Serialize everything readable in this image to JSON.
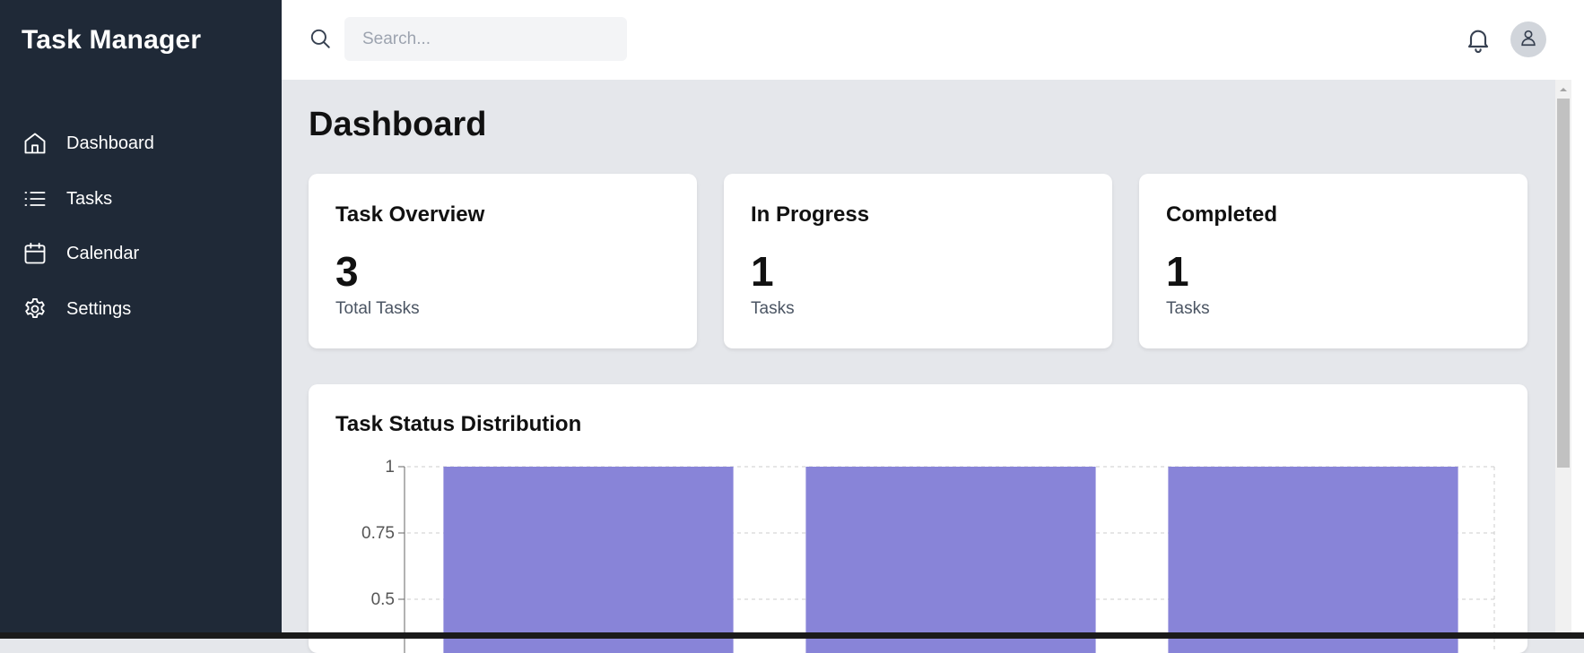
{
  "app": {
    "title": "Task Manager"
  },
  "sidebar": {
    "items": [
      {
        "label": "Dashboard",
        "icon": "home-icon"
      },
      {
        "label": "Tasks",
        "icon": "list-icon"
      },
      {
        "label": "Calendar",
        "icon": "calendar-icon"
      },
      {
        "label": "Settings",
        "icon": "gear-icon"
      }
    ]
  },
  "header": {
    "search_placeholder": "Search...",
    "search_value": "",
    "icons": [
      "search-icon",
      "bell-icon",
      "user-icon"
    ]
  },
  "main": {
    "title": "Dashboard",
    "cards": [
      {
        "title": "Task Overview",
        "value": "3",
        "subtitle": "Total Tasks"
      },
      {
        "title": "In Progress",
        "value": "1",
        "subtitle": "Tasks"
      },
      {
        "title": "Completed",
        "value": "1",
        "subtitle": "Tasks"
      }
    ],
    "chart_title": "Task Status Distribution"
  },
  "colors": {
    "sidebar_bg": "#1f2937",
    "content_bg": "#e5e7eb",
    "bar_fill": "#8884d8",
    "text_dark": "#111111",
    "text_muted": "#4b5563"
  },
  "chart_data": {
    "type": "bar",
    "title": "Task Status Distribution",
    "categories": [
      "",
      "",
      ""
    ],
    "values": [
      1,
      1,
      1
    ],
    "ylim": [
      0,
      1
    ],
    "yticks": [
      "1",
      "0.75",
      "0.5"
    ],
    "ytick_values": [
      1,
      0.75,
      0.5
    ],
    "grid": true
  }
}
